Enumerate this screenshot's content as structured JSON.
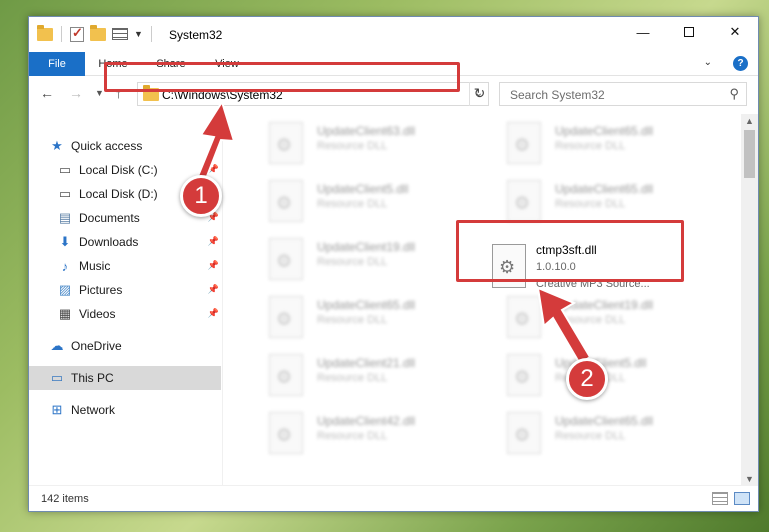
{
  "window": {
    "title": "System32",
    "controls": {
      "minimize": "—",
      "close": "✕"
    }
  },
  "ribbon": {
    "tabs": [
      "File",
      "Home",
      "Share",
      "View"
    ],
    "help": "?"
  },
  "navigation": {
    "address": "C:\\Windows\\System32",
    "search_placeholder": "Search System32"
  },
  "sidebar": {
    "items": [
      {
        "label": "Quick access",
        "icon": "star-icon",
        "pinned": false
      },
      {
        "label": "Local Disk (C:)",
        "icon": "drive-icon",
        "pinned": true
      },
      {
        "label": "Local Disk (D:)",
        "icon": "drive-icon",
        "pinned": true
      },
      {
        "label": "Documents",
        "icon": "document-icon",
        "pinned": true
      },
      {
        "label": "Downloads",
        "icon": "download-icon",
        "pinned": true
      },
      {
        "label": "Music",
        "icon": "music-icon",
        "pinned": true
      },
      {
        "label": "Pictures",
        "icon": "pictures-icon",
        "pinned": true
      },
      {
        "label": "Videos",
        "icon": "videos-icon",
        "pinned": true
      },
      {
        "label": "OneDrive",
        "icon": "cloud-icon",
        "pinned": false
      },
      {
        "label": "This PC",
        "icon": "computer-icon",
        "pinned": false,
        "selected": true
      },
      {
        "label": "Network",
        "icon": "network-icon",
        "pinned": false
      }
    ]
  },
  "files": {
    "blurred": [
      {
        "name": "UpdateClient63.dll",
        "sub": "Resource DLL"
      },
      {
        "name": "UpdateClient65.dll",
        "sub": "Resource DLL"
      },
      {
        "name": "UpdateClient5.dll",
        "sub": "Resource DLL"
      },
      {
        "name": "UpdateClient65.dll",
        "sub": "Resource DLL"
      },
      {
        "name": "UpdateClient19.dll",
        "sub": "Resource DLL"
      },
      {
        "name": "UpdateClient65.dll",
        "sub": "Resource DLL"
      },
      {
        "name": "UpdateClient19.dll",
        "sub": "Resource DLL"
      },
      {
        "name": "UpdateClient21.dll",
        "sub": "Resource DLL"
      },
      {
        "name": "UpdateClient5.dll",
        "sub": "Resource DLL"
      },
      {
        "name": "UpdateClient42.dll",
        "sub": "Resource DLL"
      },
      {
        "name": "UpdateClient65.dll",
        "sub": "Resource DLL"
      }
    ],
    "highlighted": {
      "name": "ctmp3sft.dll",
      "version": "1.0.10.0",
      "description": "Creative MP3 Source..."
    }
  },
  "status": {
    "item_count": "142 items"
  },
  "annotations": {
    "marker1": "1",
    "marker2": "2",
    "color": "#d43b3b"
  }
}
